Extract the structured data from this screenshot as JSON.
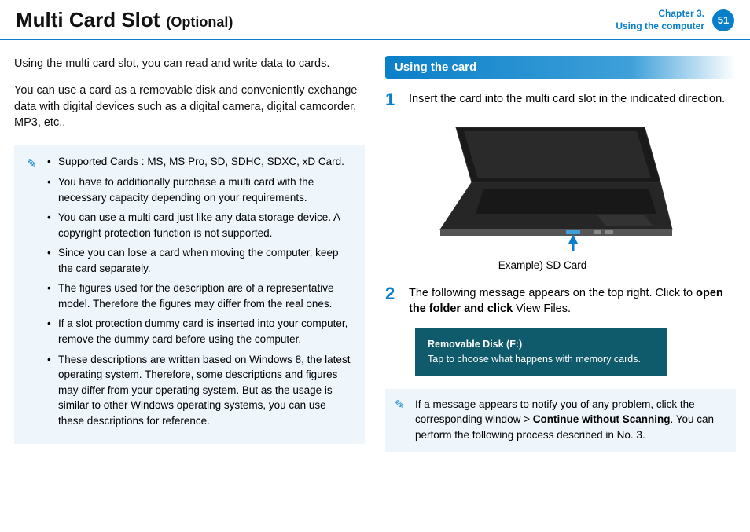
{
  "header": {
    "title_main": "Multi Card Slot",
    "title_sub": "(Optional)",
    "chapter_line1": "Chapter 3.",
    "chapter_line2": "Using the computer",
    "page_num": "51"
  },
  "left": {
    "intro1": "Using the multi card slot, you can read and write data to cards.",
    "intro2": "You can use a card as a removable disk and conveniently exchange data with digital devices such as a digital camera, digital camcorder, MP3, etc..",
    "notes": [
      "Supported Cards : MS, MS Pro, SD, SDHC, SDXC, xD Card.",
      "You have to additionally purchase a multi card with the necessary capacity depending on your requirements.",
      "You can use a multi card just like any data storage device. A copyright protection function is not supported.",
      "Since you can lose a card when moving the computer, keep the card separately.",
      "The figures used for the description are of a representative model. Therefore the figures may differ from the real ones.",
      "If a slot protection dummy card is inserted into your computer, remove the dummy card before using the computer.",
      "These descriptions are written based on Windows 8, the latest operating system. Therefore, some descriptions and figures may differ from your operating system. But as the usage is similar to other Windows operating systems, you can use these descriptions for reference."
    ]
  },
  "right": {
    "section_title": "Using the card",
    "step1_text": "Insert the card into the multi card slot in the indicated direction.",
    "fig_caption": "Example) SD Card",
    "step2_pre": "The following message appears on the top right. Click to ",
    "step2_bold": "open the folder and click",
    "step2_post": " View Files.",
    "toast_title": "Removable Disk (F:)",
    "toast_body": "Tap to choose what happens with memory cards.",
    "note2_pre": "If a message appears to notify you of any problem, click the corresponding window > ",
    "note2_bold": "Continue without Scanning",
    "note2_post": ". You can perform the following process described in No. 3."
  }
}
